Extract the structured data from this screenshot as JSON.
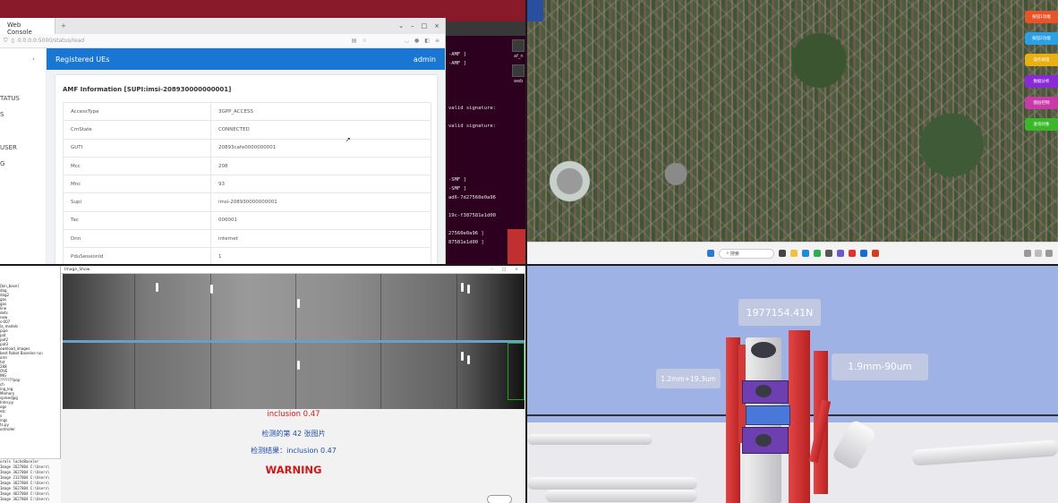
{
  "browser": {
    "tab_title": "Web Console",
    "url": "0.0.0.0:5000/status/read",
    "sidebar_items": [
      "TATUS",
      "S",
      "USER",
      "G"
    ],
    "appbar_title": "Registered UEs",
    "appbar_user": "admin",
    "card_title": "AMF Information [SUPI:imsi-208930000000001]",
    "rows": [
      {
        "key": "AccessType",
        "value": "3GPP_ACCESS"
      },
      {
        "key": "CmState",
        "value": "CONNECTED"
      },
      {
        "key": "GUTI",
        "value": "20893cafe0000000001"
      },
      {
        "key": "Mcc",
        "value": "208"
      },
      {
        "key": "Mnc",
        "value": "93"
      },
      {
        "key": "Supi",
        "value": "imsi-208930000000001"
      },
      {
        "key": "Tac",
        "value": "000001"
      },
      {
        "key": "Dnn",
        "value": "internet"
      },
      {
        "key": "PduSessionId",
        "value": "1"
      }
    ]
  },
  "terminal": {
    "lines": [
      "-AMF ]",
      "-AMF ]",
      "valid signature:",
      "valid signature:",
      "-SMF ]",
      "-SMF ]",
      "ad6-7d27560e0a96",
      "19c-f387581e1d00",
      "27560e0a96 ]",
      "87581e1d00 ]"
    ]
  },
  "desktop": {
    "icons": [
      "af_n",
      "web"
    ]
  },
  "map": {
    "buttons": [
      {
        "label": "按钮1功能",
        "color": "#e8542a"
      },
      {
        "label": "按钮2功能",
        "color": "#2aa0e8"
      },
      {
        "label": "操作按钮",
        "color": "#e8b010"
      },
      {
        "label": "数据分析",
        "color": "#8a2ad6"
      },
      {
        "label": "图层控制",
        "color": "#c83aa8"
      },
      {
        "label": "查询对象",
        "color": "#3ab82a"
      }
    ],
    "taskbar_search": "搜索"
  },
  "detect": {
    "window_title": "Image_Show",
    "file_tree": [
      "[bin_base]",
      "dag",
      "dag2",
      "gas",
      "gas",
      "line",
      "dets",
      "new",
      "s-007",
      "la_models",
      "pipe",
      "pat",
      "pat2",
      "pat3",
      "ownload_images",
      "best Robot Baseline run",
      "orm",
      "txt",
      "288",
      "OVE",
      "ING",
      "???????pop",
      "ch",
      "ing_log",
      "Memory",
      "spreedjpg",
      "Inter.py",
      "ogs",
      "etc",
      "s",
      "ings",
      "ts.py",
      "ontroller"
    ],
    "console_lines": [
      "urals  lachoBaseler",
      "Image 2627804  C:\\Users\\",
      "Image 3627804  C:\\Users\\",
      "Image 2127804  C:\\Users\\",
      "Image 3627804  C:\\Users\\",
      "Image 5627804  C:\\Users\\",
      "Image 4627804  C:\\Users\\",
      "Image 3627804  C:\\Users\\"
    ],
    "result_class": "inclusion 0.47",
    "image_index": "检测的第 42 张图片",
    "result_line": "检测结果：inclusion 0.47",
    "warning": "WARNING"
  },
  "scene": {
    "force_label": "1977154.41N",
    "left_label": "1.2mm+19.3um",
    "right_label": "1.9mm-90um"
  }
}
